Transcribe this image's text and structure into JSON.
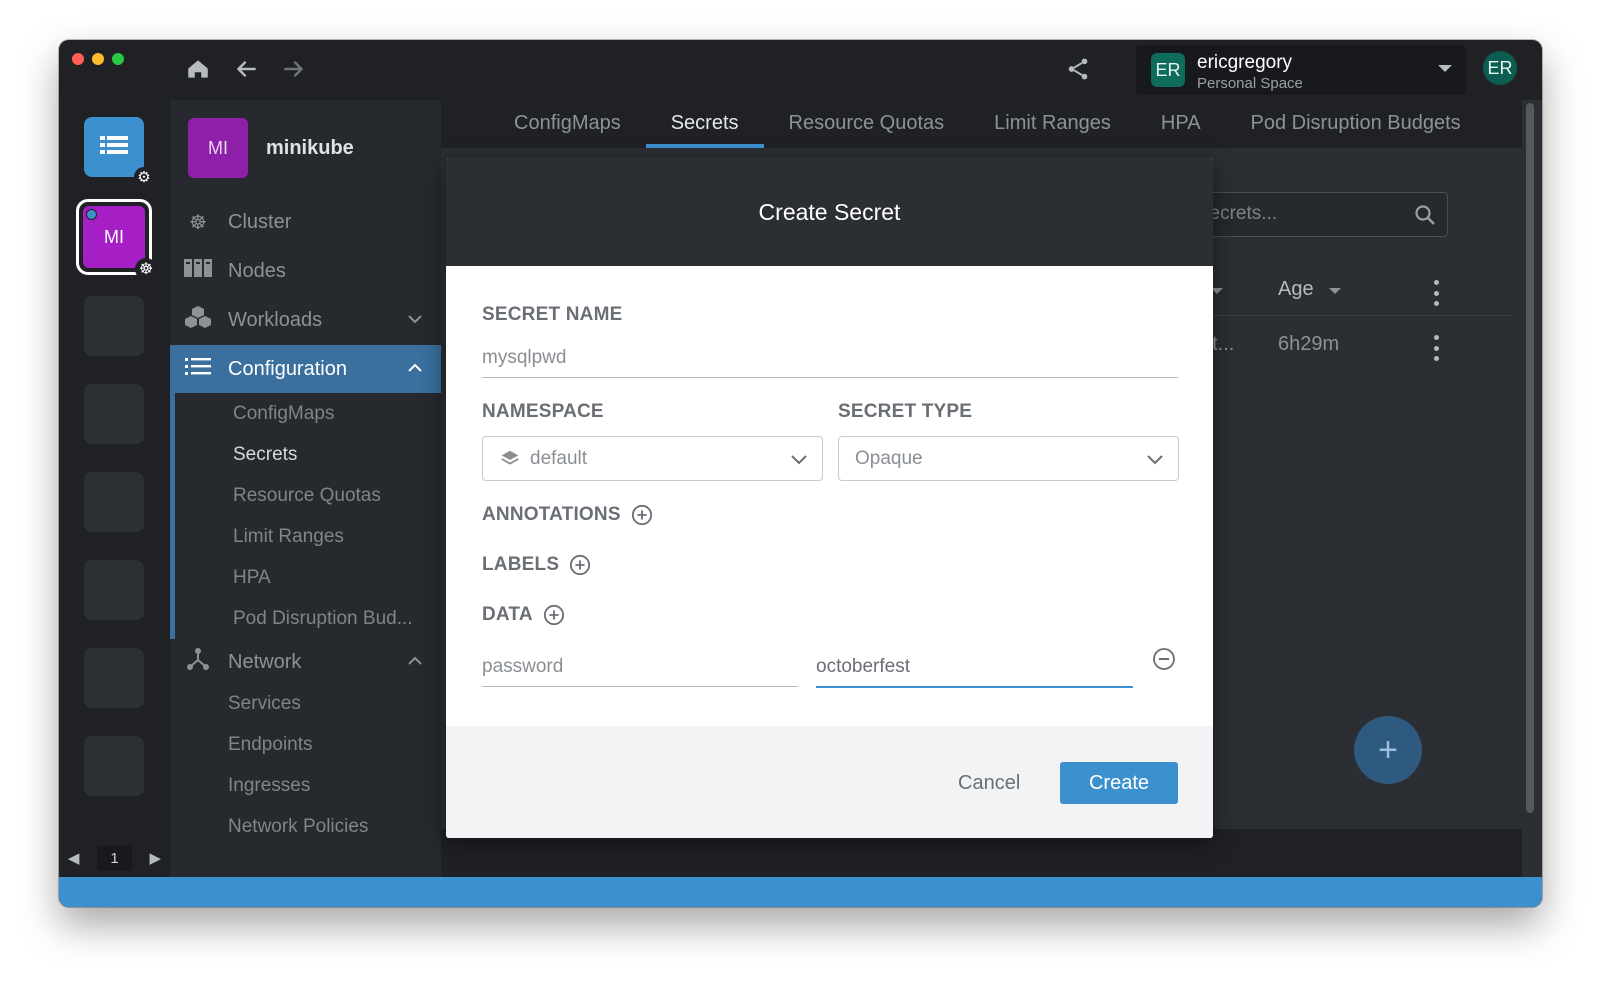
{
  "titlebar": {
    "space_initials": "ER",
    "space_name": "ericgregory",
    "space_subtitle": "Personal Space",
    "user_initials": "ER"
  },
  "hotbar": {
    "cluster_initials": "MI",
    "page_number": "1"
  },
  "sidebar": {
    "cluster_initials": "MI",
    "cluster_name": "minikube",
    "items": {
      "cluster": "Cluster",
      "nodes": "Nodes",
      "workloads": "Workloads",
      "configuration": "Configuration",
      "network": "Network"
    },
    "configuration_children": [
      "ConfigMaps",
      "Secrets",
      "Resource Quotas",
      "Limit Ranges",
      "HPA",
      "Pod Disruption Bud..."
    ],
    "network_children": [
      "Services",
      "Endpoints",
      "Ingresses",
      "Network Policies"
    ]
  },
  "tabs": [
    "ConfigMaps",
    "Secrets",
    "Resource Quotas",
    "Limit Ranges",
    "HPA",
    "Pod Disruption Budgets"
  ],
  "list": {
    "search_placeholder": "n Secrets...",
    "age_header": "Age",
    "row_name": "et...",
    "row_age": "6h29m"
  },
  "dialog": {
    "title": "Create Secret",
    "secret_name_label": "SECRET NAME",
    "secret_name_value": "mysqlpwd",
    "namespace_label": "NAMESPACE",
    "namespace_value": "default",
    "secret_type_label": "SECRET TYPE",
    "secret_type_value": "Opaque",
    "annotations_label": "ANNOTATIONS",
    "labels_label": "LABELS",
    "data_label": "DATA",
    "data_key": "password",
    "data_value": "octoberfest",
    "cancel_label": "Cancel",
    "create_label": "Create"
  },
  "colors": {
    "accent": "#3d90ce",
    "cluster_avatar": "#a61fc4",
    "user_avatar": "#0f6b5c"
  }
}
